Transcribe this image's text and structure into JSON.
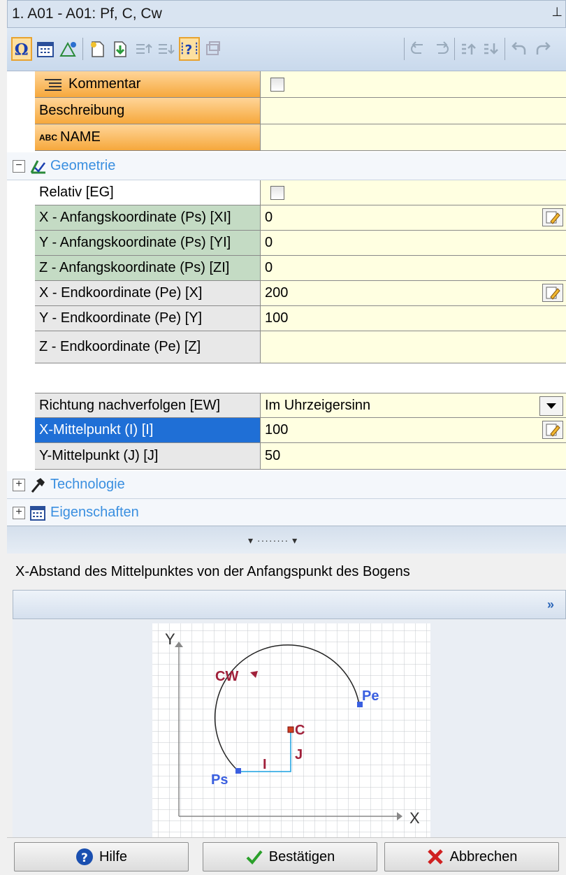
{
  "window": {
    "title": "1. A01 - A01: Pf, C, Cw",
    "pin_icon": "pin-icon"
  },
  "toolbar": {
    "icons": [
      "omega-icon",
      "calendar-icon",
      "geometry-icon",
      "new-icon",
      "import-icon",
      "move-up-icon",
      "move-down-icon",
      "help-query-icon",
      "disabled-icon",
      "undo-list-icon",
      "redo-list-icon",
      "arrow-up-icon",
      "arrow-down-icon",
      "undo-icon",
      "redo-icon"
    ]
  },
  "properties": {
    "kommentar": {
      "label": "Kommentar",
      "checked": false
    },
    "beschreibung": {
      "label": "Beschreibung",
      "value": ""
    },
    "name": {
      "prefix": "ABC",
      "label": "NAME",
      "value": ""
    },
    "geometrie": {
      "label": "Geometrie",
      "expander": "−"
    },
    "relativ": {
      "label": "Relativ [EG]",
      "checked": false
    },
    "xi": {
      "label": "X - Anfangskoordinate (Ps) [XI]",
      "value": "0"
    },
    "yi": {
      "label": "Y - Anfangskoordinate (Ps) [YI]",
      "value": "0"
    },
    "zi": {
      "label": "Z - Anfangskoordinate (Ps) [ZI]",
      "value": "0"
    },
    "x": {
      "label": "X - Endkoordinate (Pe) [X]",
      "value": "200"
    },
    "y": {
      "label": "Y - Endkoordinate (Pe) [Y]",
      "value": "100"
    },
    "z": {
      "label": "Z - Endkoordinate (Pe) [Z]",
      "value": ""
    },
    "ew": {
      "label": "Richtung nachverfolgen [EW]",
      "value": "Im Uhrzeigersinn"
    },
    "i": {
      "label": "X-Mittelpunkt (I) [I]",
      "value": "100"
    },
    "j": {
      "label": "Y-Mittelpunkt (J) [J]",
      "value": "50"
    },
    "technologie": {
      "label": "Technologie",
      "expander": "+"
    },
    "eigenschaften": {
      "label": "Eigenschaften",
      "expander": "+"
    }
  },
  "description": "X-Abstand des Mittelpunktes von der Anfangspunkt des Bogens",
  "diagram": {
    "axis_y": "Y",
    "axis_x": "X",
    "cw": "CW",
    "pe": "Pe",
    "c": "C",
    "j": "J",
    "i": "I",
    "ps": "Ps",
    "colors": {
      "accent": "#a0203a",
      "point": "#3a5fe0",
      "line": "#1aa0e0"
    }
  },
  "footer": {
    "hilfe": "Hilfe",
    "bestaetigen": "Bestätigen",
    "abbrechen": "Abbrechen"
  }
}
